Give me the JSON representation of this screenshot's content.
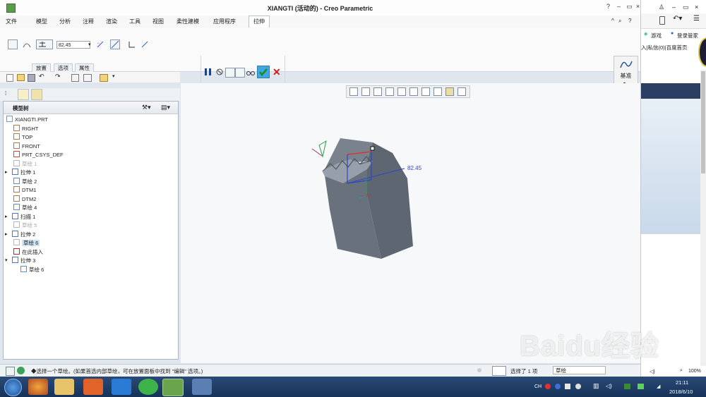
{
  "window": {
    "title": "XIANGTI (活动的) - Creo Parametric"
  },
  "menu": [
    "文件",
    "模型",
    "分析",
    "注释",
    "渲染",
    "工具",
    "视图",
    "柔性建模",
    "应用程序"
  ],
  "active_tab": "拉伸",
  "ribbon": {
    "depth_value": "82.45",
    "subtabs": [
      "放置",
      "选项",
      "属性"
    ],
    "datum_label": "基准"
  },
  "model_tree": {
    "header": "模型树",
    "items": [
      {
        "label": "XIANGTI.PRT",
        "dim": false
      },
      {
        "label": "RIGHT",
        "dim": false
      },
      {
        "label": "TOP",
        "dim": false
      },
      {
        "label": "FRONT",
        "dim": false
      },
      {
        "label": "PRT_CSYS_DEF",
        "dim": false
      },
      {
        "label": "草绘 1",
        "dim": true
      },
      {
        "label": "拉伸 1",
        "dim": false
      },
      {
        "label": "草绘 2",
        "dim": false
      },
      {
        "label": "DTM1",
        "dim": false
      },
      {
        "label": "DTM2",
        "dim": false
      },
      {
        "label": "草绘 4",
        "dim": false
      },
      {
        "label": "扫描 1",
        "dim": false
      },
      {
        "label": "草绘 5",
        "dim": true
      },
      {
        "label": "拉伸 2",
        "dim": false
      },
      {
        "label": "草绘 6",
        "dim": false
      },
      {
        "label": "在此插入",
        "dim": false
      },
      {
        "label": "拉伸 3",
        "dim": false
      },
      {
        "label": "草绘 6",
        "dim": false
      }
    ]
  },
  "viewport": {
    "dimension_label": "82.45"
  },
  "status": {
    "message": "◆选择一个草绘。(如果首选内部草绘，可在放置面板中找到 \"编辑\" 选项。)",
    "selected": "选择了 1 项",
    "filter": "草绘"
  },
  "browser": {
    "game_label": "游戏",
    "login_label": "登录管家",
    "line1": "入|私信(0)|百度首页",
    "zoom": "100%"
  },
  "taskbar": {
    "time": "21:11",
    "date": "2018/6/10",
    "lang": "CH"
  },
  "watermark": "Baidu经验",
  "colors": {
    "model": "#626b75",
    "accent": "#2a62b8",
    "taskbar": "#1e3d68"
  }
}
